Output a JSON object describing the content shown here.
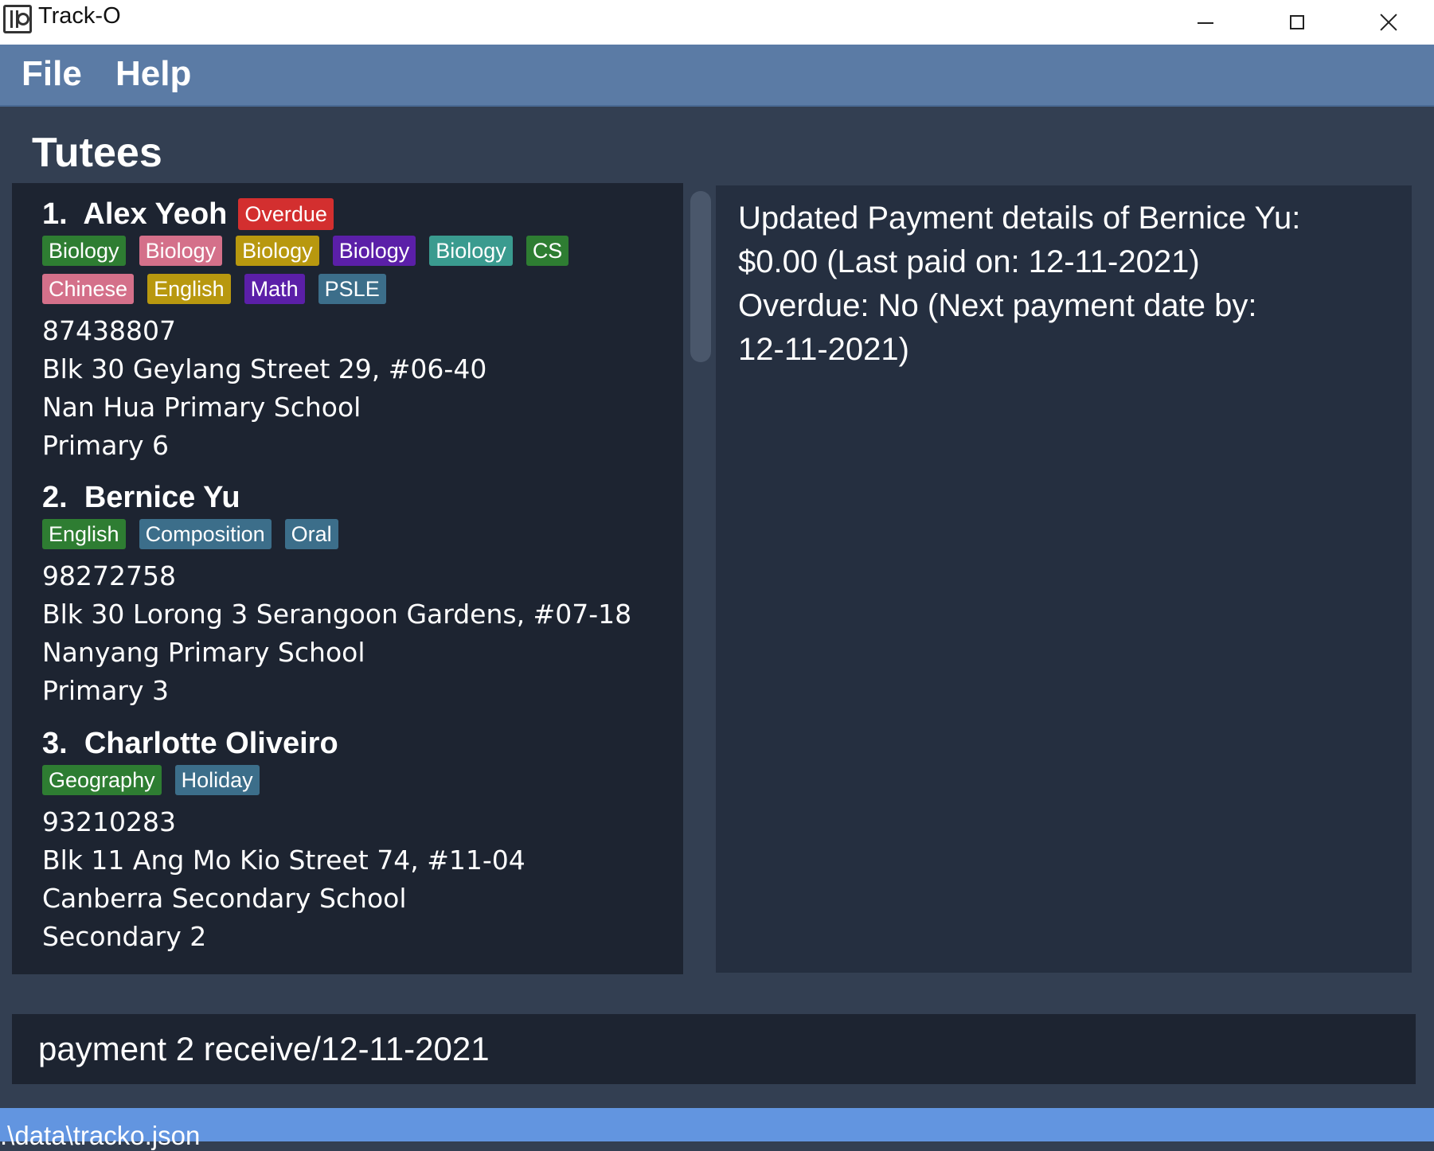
{
  "window": {
    "title": "Track-O",
    "icon": "contact-book-icon"
  },
  "menu": {
    "file": "File",
    "help": "Help"
  },
  "list": {
    "title": "Tutees",
    "tutees": [
      {
        "index": "1.",
        "name": "Alex Yeoh",
        "status_badge": "Overdue",
        "tags": [
          {
            "label": "Biology",
            "color": "#2e7d32"
          },
          {
            "label": "Biology",
            "color": "#d4708a"
          },
          {
            "label": "Biology",
            "color": "#b8980f"
          },
          {
            "label": "Biology",
            "color": "#5b1fa8"
          },
          {
            "label": "Biology",
            "color": "#3a9b8f"
          },
          {
            "label": "CS",
            "color": "#2e7d32"
          },
          {
            "label": "Chinese",
            "color": "#d4708a"
          },
          {
            "label": "English",
            "color": "#b8980f"
          },
          {
            "label": "Math",
            "color": "#5b1fa8"
          },
          {
            "label": "PSLE",
            "color": "#3c6e8a"
          }
        ],
        "phone": "87438807",
        "address": "Blk 30 Geylang Street 29, #06-40",
        "school": "Nan Hua Primary School",
        "level": "Primary 6"
      },
      {
        "index": "2.",
        "name": "Bernice Yu",
        "tags": [
          {
            "label": "English",
            "color": "#2e7d32"
          },
          {
            "label": "Composition",
            "color": "#3c6e8a"
          },
          {
            "label": "Oral",
            "color": "#3c6e8a"
          }
        ],
        "phone": "98272758",
        "address": "Blk 30 Lorong 3 Serangoon Gardens, #07-18",
        "school": "Nanyang Primary School",
        "level": "Primary 3"
      },
      {
        "index": "3.",
        "name": "Charlotte Oliveiro",
        "tags": [
          {
            "label": "Geography",
            "color": "#2e7d32"
          },
          {
            "label": "Holiday",
            "color": "#3c6e8a"
          }
        ],
        "phone": "93210283",
        "address": "Blk 11 Ang Mo Kio Street 74, #11-04",
        "school": "Canberra Secondary School",
        "level": "Secondary 2"
      }
    ]
  },
  "result": {
    "message": "Updated Payment details of Bernice Yu:\n$0.00 (Last paid on: 12-11-2021)\nOverdue: No (Next payment date by:\n12-11-2021)"
  },
  "command": {
    "value": "payment 2 receive/12-11-2021"
  },
  "status": {
    "path": ".\\data\\tracko.json"
  },
  "colors": {
    "menubar": "#5b7ba5",
    "background": "#333f52",
    "list_panel": "#1d2431",
    "result_panel": "#252f40",
    "statusbar": "#6295e0",
    "overdue": "#d32f2f"
  }
}
